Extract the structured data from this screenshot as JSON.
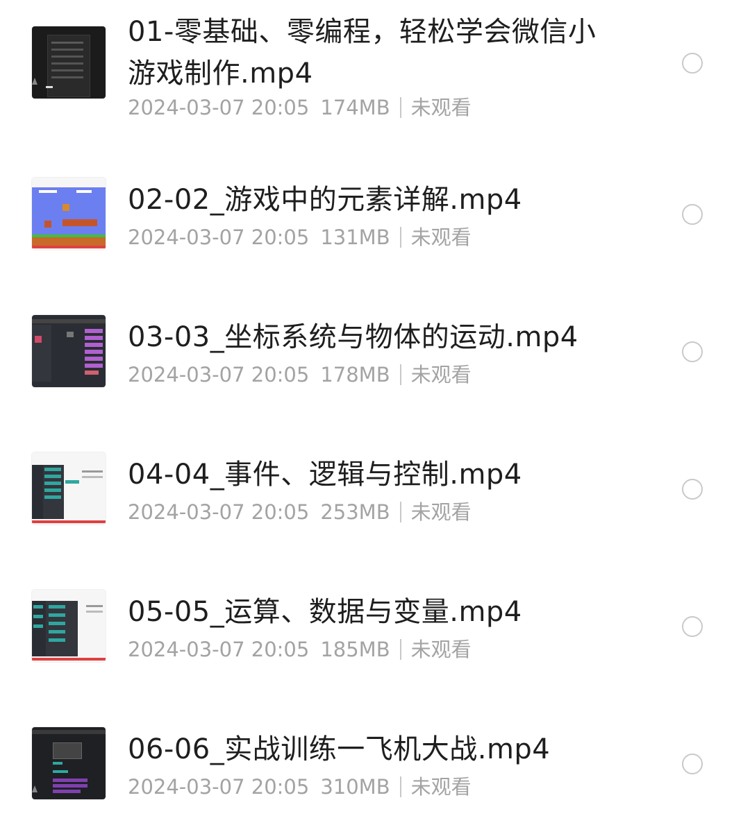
{
  "files": [
    {
      "title": "01-零基础、零编程，轻松学会微信小游戏制作.mp4",
      "date": "2024-03-07 20:05",
      "size": "174MB",
      "status": "未观看",
      "thumb": "dark-editor"
    },
    {
      "title": "02-02_游戏中的元素详解.mp4",
      "date": "2024-03-07 20:05",
      "size": "131MB",
      "status": "未观看",
      "thumb": "mario-game"
    },
    {
      "title": "03-03_坐标系统与物体的运动.mp4",
      "date": "2024-03-07 20:05",
      "size": "178MB",
      "status": "未观看",
      "thumb": "dark-blocks-editor"
    },
    {
      "title": "04-04_事件、逻辑与控制.mp4",
      "date": "2024-03-07 20:05",
      "size": "253MB",
      "status": "未观看",
      "thumb": "light-blocks-editor"
    },
    {
      "title": "05-05_运算、数据与变量.mp4",
      "date": "2024-03-07 20:05",
      "size": "185MB",
      "status": "未观看",
      "thumb": "light-blocks-editor"
    },
    {
      "title": "06-06_实战训练一飞机大战.mp4",
      "date": "2024-03-07 20:05",
      "size": "310MB",
      "status": "未观看",
      "thumb": "dark-editor-purple"
    }
  ],
  "colors": {
    "title": "#1e1e1e",
    "meta": "#a3a3a3",
    "radio_border": "#c9c9c9"
  }
}
